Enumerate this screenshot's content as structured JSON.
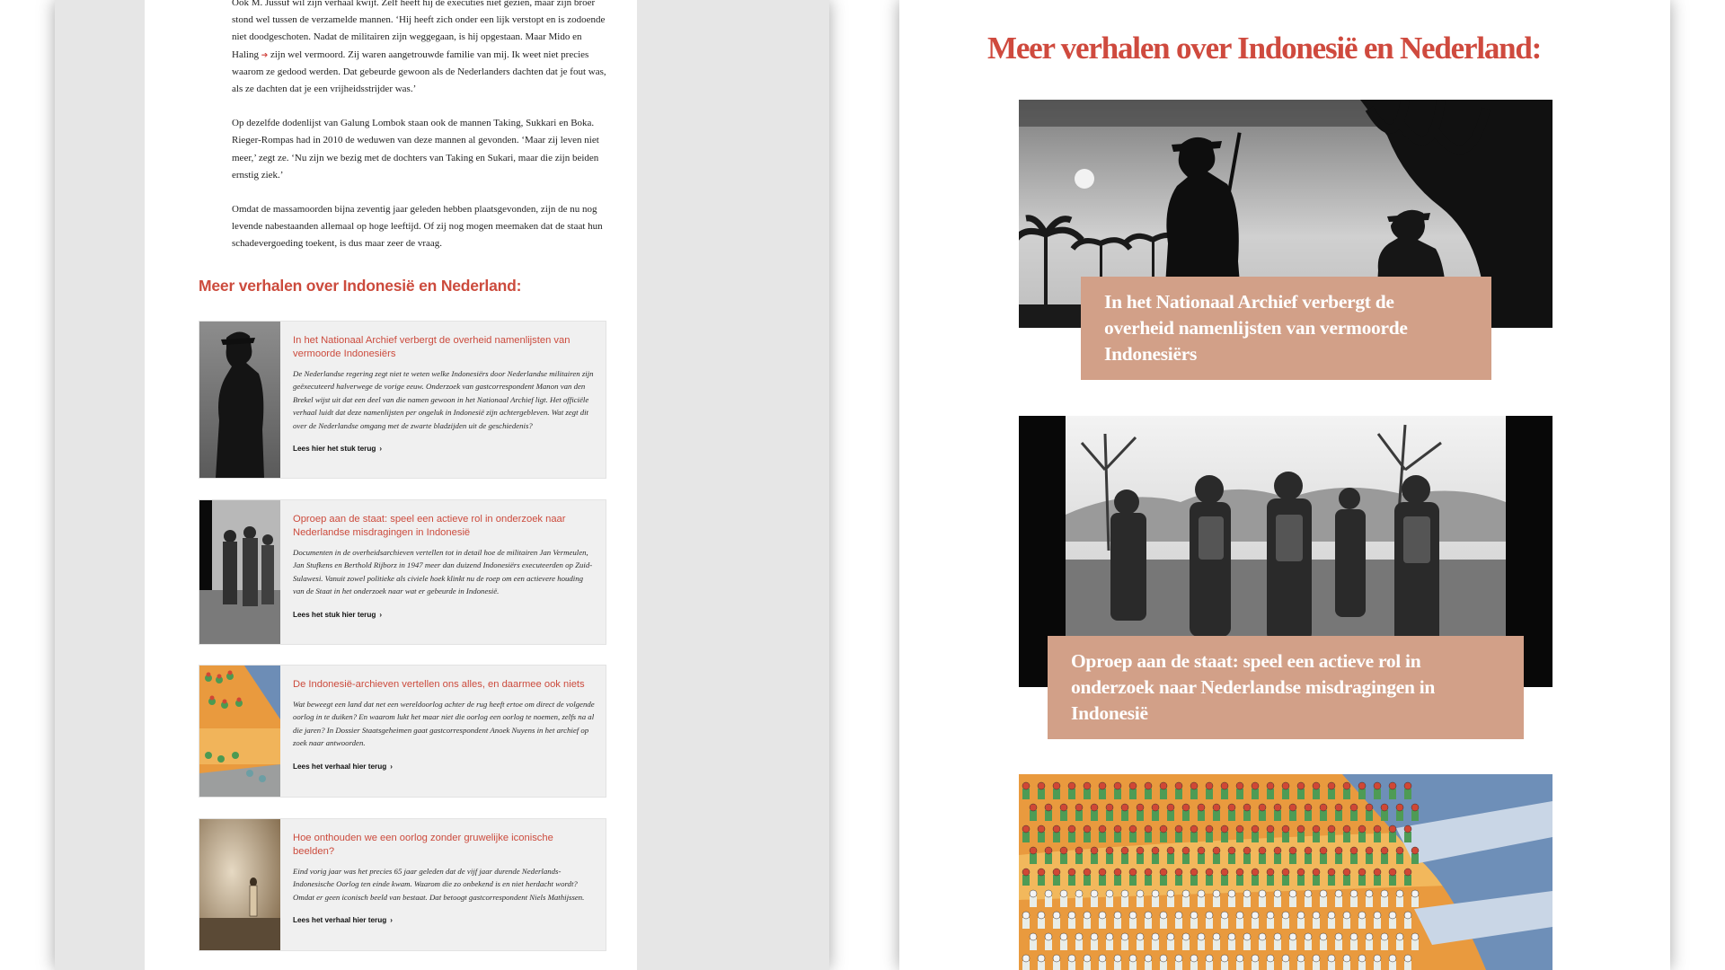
{
  "left": {
    "article_paragraphs": [
      "Ook M. Jussuf wil zijn verhaal kwijt. Zelf heeft hij de executies niet gezien, maar zijn broer stond wel tussen de verzamelde mannen. ‘Hij heeft zich onder een lijk verstopt en is zodoende niet doodgeschoten. Nadat de militairen zijn weggegaan, is hij opgestaan. Maar Mido en Haling",
      "zijn wel vermoord. Zij waren aangetrouwde familie van mij. Ik weet niet precies waarom ze gedood werden. Dat gebeurde gewoon als de Nederlanders dachten dat je fout was, als ze dachten dat je een vrijheidsstrijder was.’",
      "Op dezelfde dodenlijst van Galung Lombok staan ook de mannen Taking, Sukkari en Boka. Rieger-Rompas had in 2010 de weduwen van deze mannen al gevonden. ‘Maar zij leven niet meer,’ zegt ze. ‘Nu zijn we bezig met de dochters van Taking en Sukari, maar die zijn beiden ernstig ziek.’",
      "Omdat de massamoorden bijna zeventig jaar geleden hebben plaatsgevonden, zijn de nu nog levende nabestaanden allemaal op hoge leeftijd. Of zij nog mogen meemaken dat de staat hun schadevergoeding toekent, is dus maar zeer de vraag."
    ],
    "related_heading": "Meer verhalen over Indonesië en Nederland:",
    "cards": [
      {
        "title": "In het Nationaal Archief verbergt de overheid namenlijsten van vermoorde Indonesiërs",
        "summary": "De Nederlandse regering zegt niet te weten welke Indonesiërs door Nederlandse militairen zijn geëxecuteerd halverwege de vorige eeuw. Onderzoek van gastcorrespondent Manon van den Brekel wijst uit dat een deel van die namen gewoon in het Nationaal Archief ligt. Het officiële verhaal luidt dat deze namenlijsten per ongeluk in Indonesië zijn achtergebleven. Wat zegt dit over de Nederlandse omgang met de zwarte bladzijden uit de geschiedenis?",
        "link": "Lees hier het stuk terug"
      },
      {
        "title": "Oproep aan de staat: speel een actieve rol in onderzoek naar Nederlandse misdragingen in Indonesië",
        "summary": "Documenten in de overheidsarchieven vertellen tot in detail hoe de militairen Jan Vermeulen, Jan Stufkens en Berthold Rijborz in 1947 meer dan duizend Indonesiërs executeerden op Zuid-Sulawesi. Vanuit zowel politieke als civiele hoek klinkt nu de roep om een actievere houding van de Staat in het onderzoek naar wat er gebeurde in Indonesië.",
        "link": "Lees het stuk hier terug"
      },
      {
        "title": "De Indonesië-archieven vertellen ons alles, en daarmee ook niets",
        "summary": "Wat beweegt een land dat net een wereldoorlog achter de rug heeft ertoe om direct de volgende oorlog in te duiken? En waarom lukt het maar niet die oorlog een oorlog te noemen, zelfs na al die jaren? In Dossier Staatsgeheimen gaat gastcorrespondent Anoek Nuyens in het archief op zoek naar antwoorden.",
        "link": "Lees het verhaal hier terug"
      },
      {
        "title": "Hoe onthouden we een oorlog zonder gruwelijke iconische beelden?",
        "summary": "Eind vorig jaar was het precies 65 jaar geleden dat de vijf jaar durende Nederlands-Indonesische Oorlog ten einde kwam. Waarom die zo onbekend is en niet herdacht wordt? Omdat er geen iconisch beeld van bestaat. Dat betoogt gastcorrespondent Niels Mathijssen.",
        "link": "Lees het verhaal hier terug"
      }
    ]
  },
  "right": {
    "heading": "Meer verhalen over Indonesië en Nederland:",
    "cards": [
      {
        "caption": "In het Nationaal Archief verbergt de overheid namenlijsten van vermoorde Indonesiërs"
      },
      {
        "caption": "Oproep aan de staat: speel een actieve rol in onderzoek naar Nederlandse misdragingen in Indonesië"
      }
    ]
  },
  "colors": {
    "accent": "#cc4b3d",
    "caption_bg": "#d2a088",
    "card_bg": "#f0f0f0",
    "gutter": "#e6e6e6"
  }
}
